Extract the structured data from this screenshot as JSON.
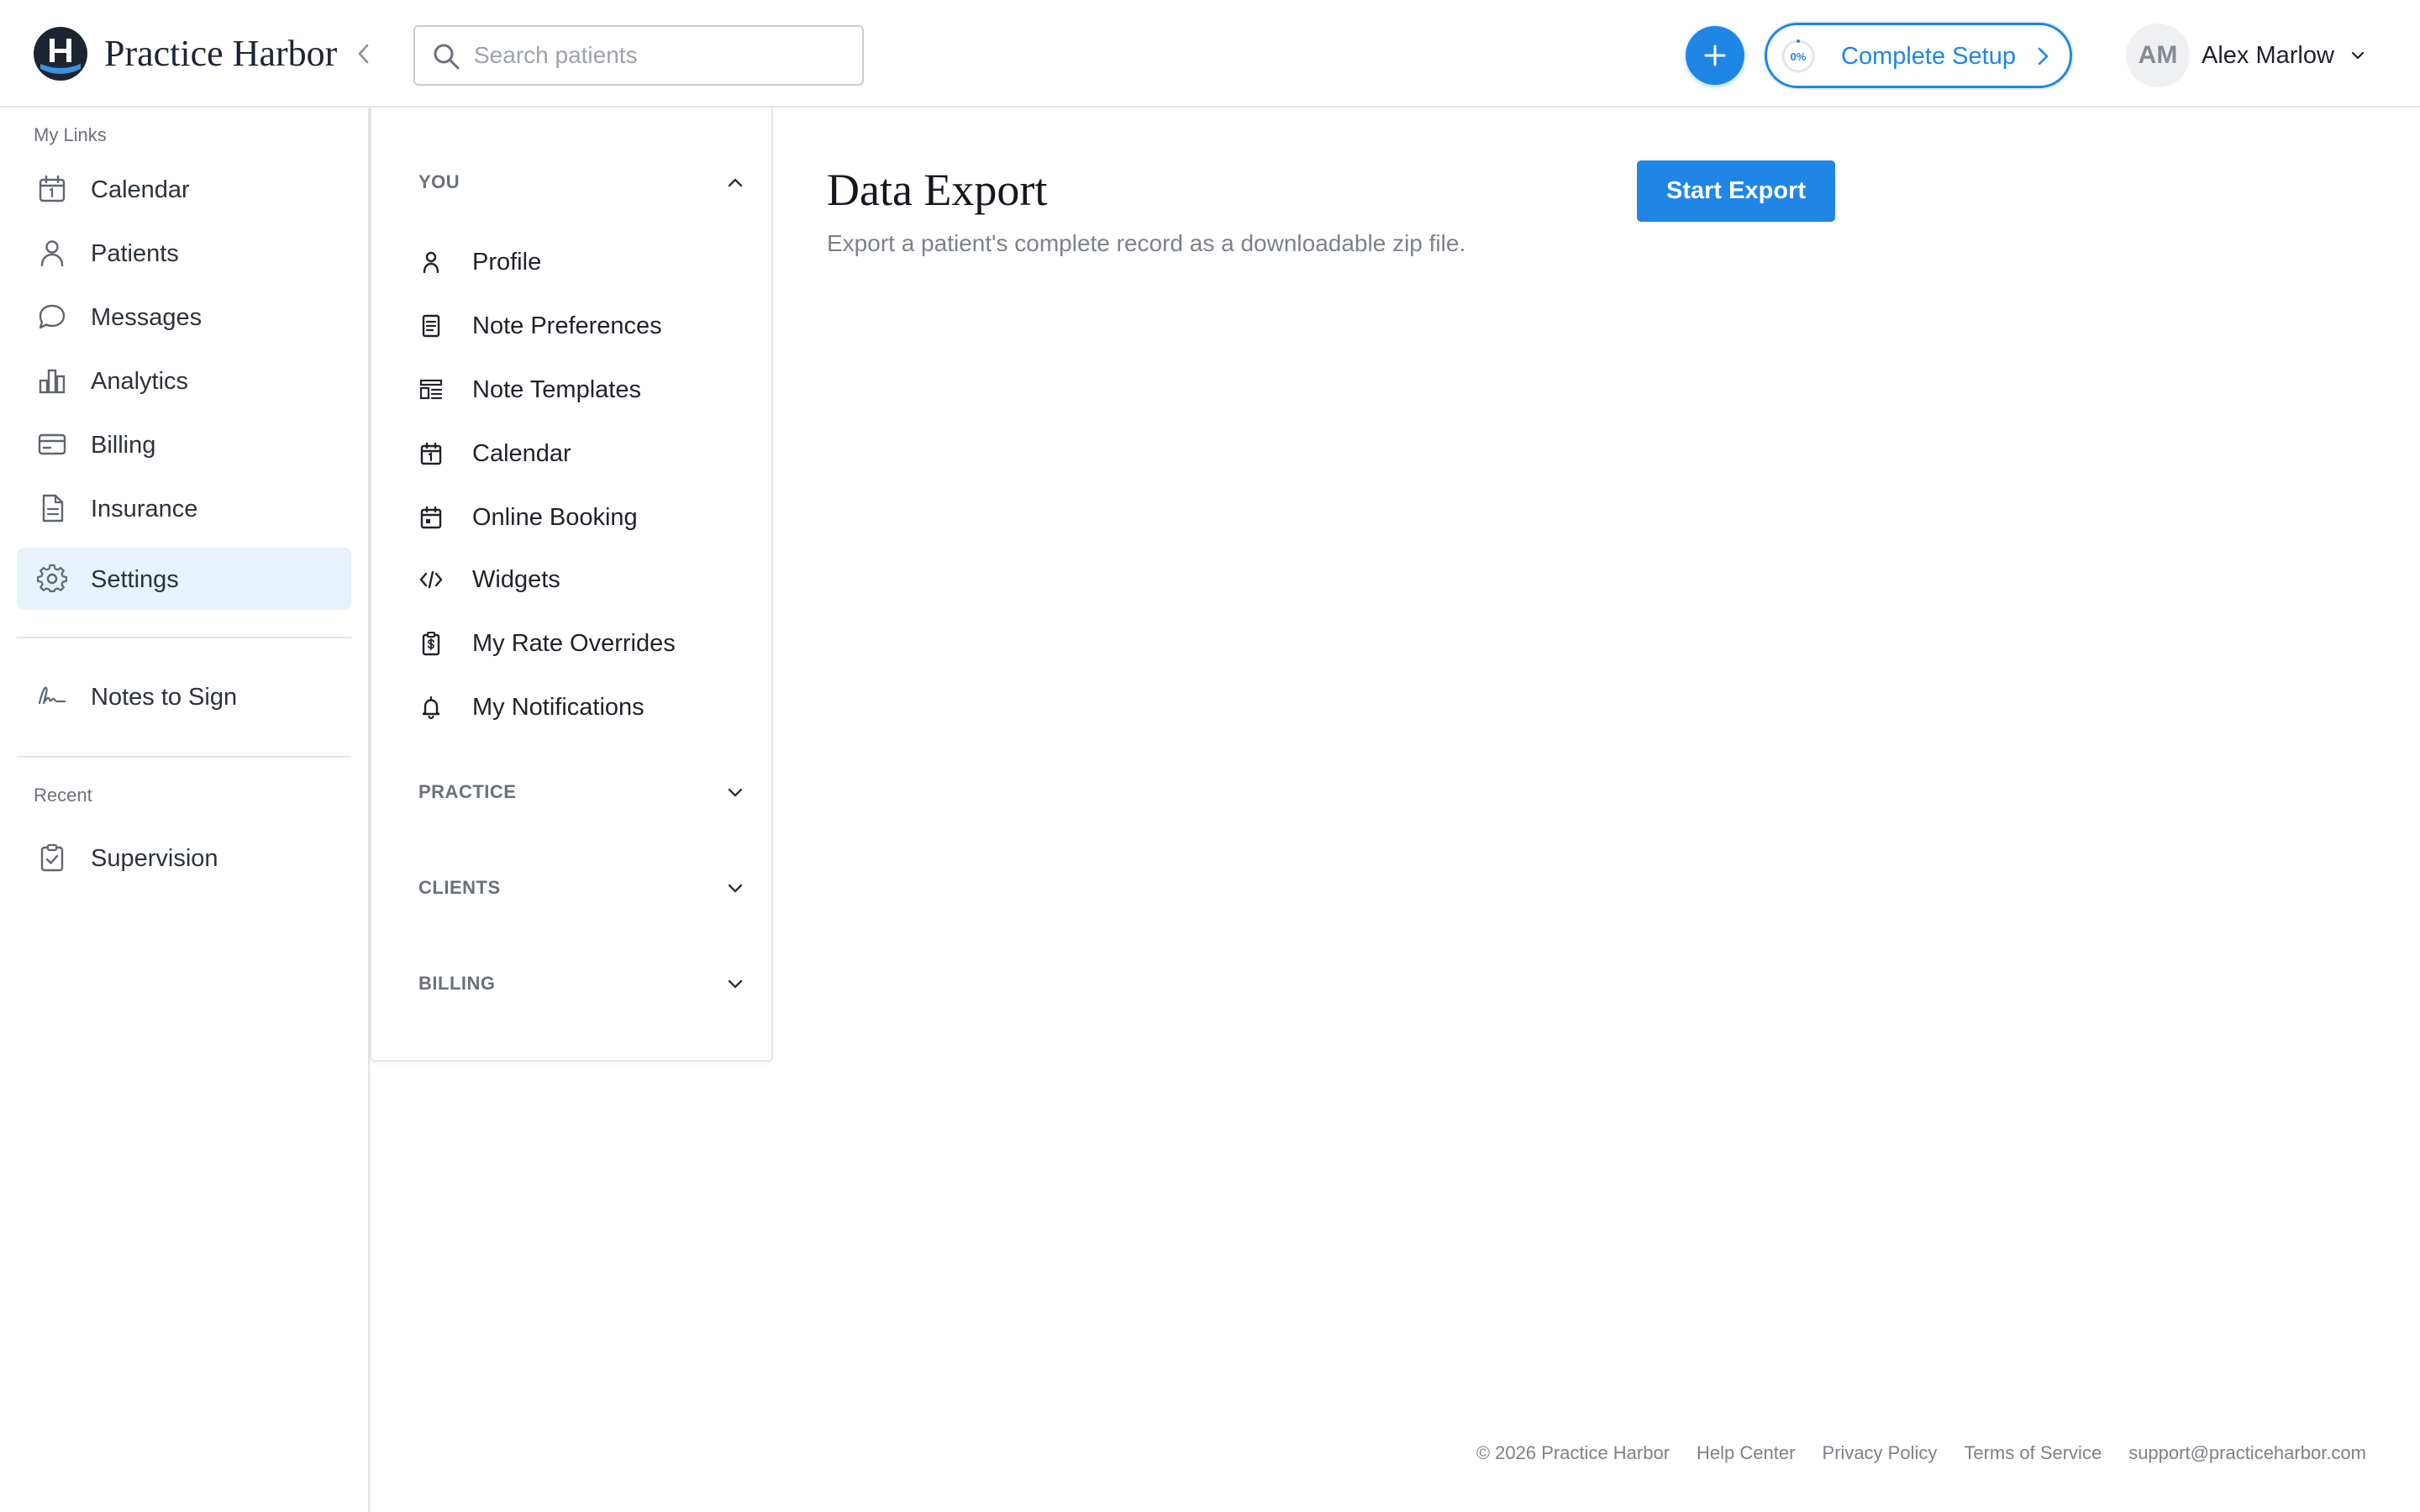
{
  "header": {
    "brand": "Practice Harbor",
    "search_placeholder": "Search patients",
    "setup_percent": "0%",
    "setup_label": "Complete Setup",
    "user_initials": "AM",
    "user_name": "Alex Marlow"
  },
  "sidebar": {
    "my_links_label": "My Links",
    "items": [
      {
        "label": "Calendar",
        "icon": "calendar-icon"
      },
      {
        "label": "Patients",
        "icon": "user-icon"
      },
      {
        "label": "Messages",
        "icon": "chat-icon"
      },
      {
        "label": "Analytics",
        "icon": "bar-chart-icon"
      },
      {
        "label": "Billing",
        "icon": "credit-card-icon"
      },
      {
        "label": "Insurance",
        "icon": "document-icon"
      },
      {
        "label": "Settings",
        "icon": "gear-icon",
        "active": true
      }
    ],
    "notes_to_sign": "Notes to Sign",
    "recent_label": "Recent",
    "recent_items": [
      {
        "label": "Supervision",
        "icon": "clipboard-check-icon"
      }
    ]
  },
  "settings_menu": {
    "groups": [
      {
        "label": "YOU",
        "expanded": true,
        "items": [
          {
            "label": "Profile",
            "icon": "user-icon"
          },
          {
            "label": "Note Preferences",
            "icon": "note-icon"
          },
          {
            "label": "Note Templates",
            "icon": "template-icon"
          },
          {
            "label": "Calendar",
            "icon": "calendar-icon"
          },
          {
            "label": "Online Booking",
            "icon": "calendar-icon"
          },
          {
            "label": "Widgets",
            "icon": "code-icon"
          },
          {
            "label": "My Rate Overrides",
            "icon": "dollar-clipboard-icon"
          },
          {
            "label": "My Notifications",
            "icon": "bell-icon"
          }
        ]
      },
      {
        "label": "PRACTICE",
        "expanded": false
      },
      {
        "label": "CLIENTS",
        "expanded": false
      },
      {
        "label": "BILLING",
        "expanded": false
      }
    ]
  },
  "main": {
    "title": "Data Export",
    "description": "Export a patient's complete record as a downloadable zip file.",
    "export_button": "Start Export"
  },
  "footer": {
    "copyright": "© 2026 Practice Harbor",
    "links": [
      "Help Center",
      "Privacy Policy",
      "Terms of Service",
      "support@practiceharbor.com"
    ]
  },
  "colors": {
    "accent": "#1f86e5",
    "active_bg": "#e8f2fc",
    "brand_dark": "#1d2533"
  }
}
